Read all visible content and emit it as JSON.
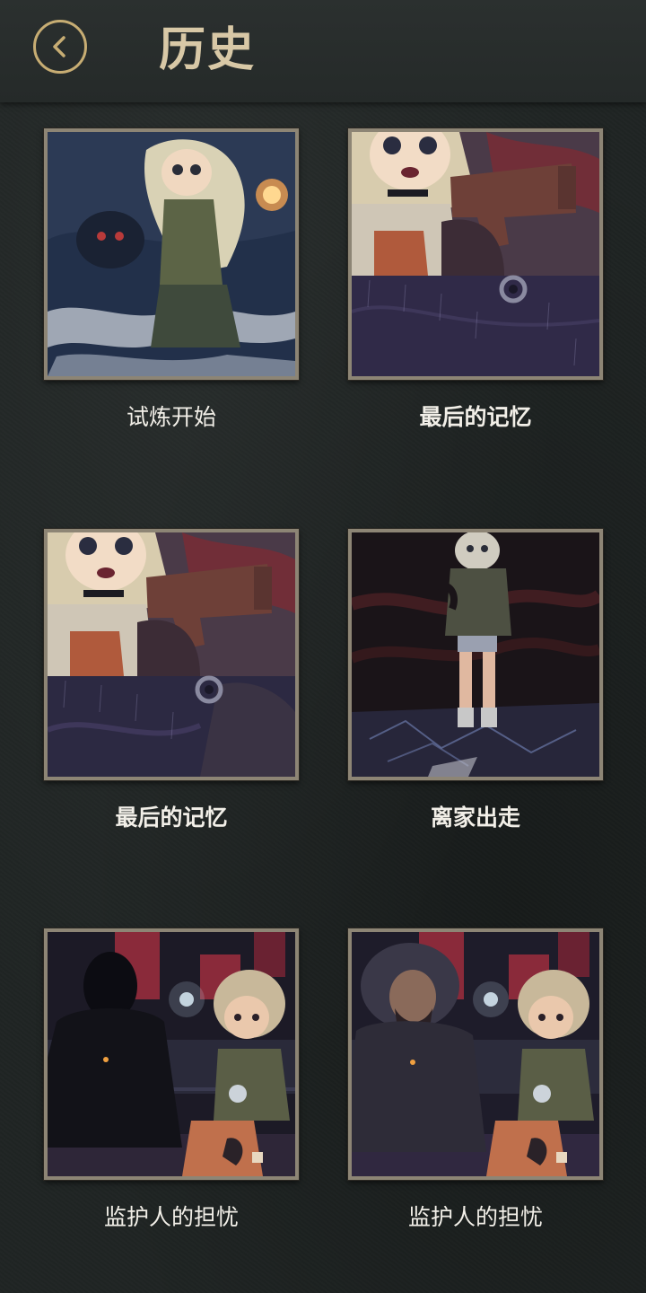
{
  "header": {
    "title": "历史",
    "back_icon": "chevron-left-icon",
    "accent_color": "#c7ad73"
  },
  "entries": [
    {
      "label": "试炼开始",
      "scene": "girl-trial-start"
    },
    {
      "label": "最后的记忆",
      "scene": "girl-with-pistol"
    },
    {
      "label": "最后的记忆",
      "scene": "girl-with-pistol"
    },
    {
      "label": "离家出走",
      "scene": "girl-standing-alone"
    },
    {
      "label": "监护人的担忧",
      "scene": "guardian-shadow-bench"
    },
    {
      "label": "监护人的担忧",
      "scene": "guardian-bench"
    }
  ]
}
